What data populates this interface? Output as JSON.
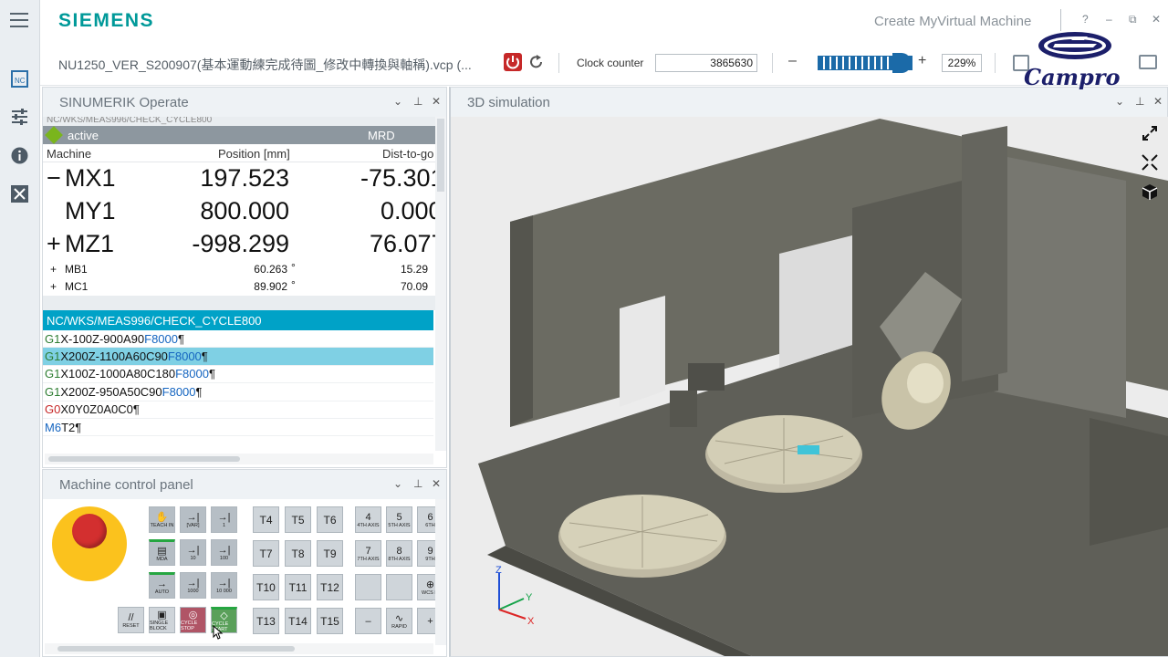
{
  "header": {
    "brand": "SIEMENS",
    "app_title": "Create MyVirtual Machine",
    "help": "?",
    "minimize": "–",
    "restore": "⧉",
    "close": "✕"
  },
  "toolbar": {
    "filename": "NU1250_VER_S200907(基本運動練完成待圖_修改中轉換與軸稱).vcp (...",
    "clock_label": "Clock counter",
    "clock_value": "3865630",
    "zoom_minus": "–",
    "zoom_plus": "+",
    "zoom_value": "229%",
    "zoom_level": 0.82
  },
  "logo": {
    "text": "Campro",
    "color": "#1c1f6a"
  },
  "left_rail": {
    "icons": [
      "menu-icon",
      "nc-icon",
      "settings-sliders-icon",
      "info-icon",
      "close-box-icon"
    ]
  },
  "sinumerik": {
    "title": "SINUMERIK Operate",
    "cut_path": "NC/WKS/MEAS996/CHECK_CYCLE800",
    "status": "active",
    "mode": "MRD",
    "headers": {
      "machine": "Machine",
      "position": "Position [mm]",
      "dist": "Dist-to-go"
    },
    "axes_big": [
      {
        "sign": "−",
        "name": "MX1",
        "pos": "197.523",
        "dist": "-75.301"
      },
      {
        "sign": "",
        "name": "MY1",
        "pos": "800.000",
        "dist": "0.000"
      },
      {
        "sign": "+",
        "name": "MZ1",
        "pos": "-998.299",
        "dist": "76.077"
      }
    ],
    "axes_small": [
      {
        "sign": "+",
        "name": "MB1",
        "pos": "60.263",
        "unit": "°",
        "dist": "15.29"
      },
      {
        "sign": "+",
        "name": "MC1",
        "pos": "89.902",
        "unit": "°",
        "dist": "70.09"
      }
    ],
    "program_path": "NC/WKS/MEAS996/CHECK_CYCLE800",
    "program": [
      {
        "g": "G1",
        "body": "X-100Z-900A90",
        "feed": "F8000",
        "end": "¶",
        "selected": false
      },
      {
        "g": "G1",
        "body": "X200Z-1100A60C90",
        "feed": "F8000",
        "end": "¶",
        "selected": true
      },
      {
        "g": "G1",
        "body": "X100Z-1000A80C180",
        "feed": "F8000",
        "end": "¶",
        "selected": false
      },
      {
        "g": "G1",
        "body": "X200Z-950A50C90",
        "feed": "F8000",
        "end": "¶",
        "selected": false
      },
      {
        "g": "G0",
        "body": "X0Y0Z0A0C0",
        "feed": "",
        "end": "¶",
        "selected": false
      },
      {
        "g": "M6",
        "body": " T2",
        "feed": "",
        "end": "¶",
        "selected": false
      }
    ]
  },
  "mcp": {
    "title": "Machine control panel",
    "mode_keys": [
      {
        "glyph": "✋",
        "label": "TEACH IN"
      },
      {
        "glyph": "→|",
        "label": "[VAR]"
      },
      {
        "glyph": "→|",
        "label": "1"
      },
      {
        "glyph": "▤",
        "label": "MDA"
      },
      {
        "glyph": "→|",
        "label": "10"
      },
      {
        "glyph": "→|",
        "label": "100"
      },
      {
        "glyph": "→",
        "label": "AUTO"
      },
      {
        "glyph": "→|",
        "label": "1000"
      },
      {
        "glyph": "→|",
        "label": "10 000"
      }
    ],
    "tool_keys": [
      "T4",
      "T5",
      "T6",
      "T7",
      "T8",
      "T9",
      "T10",
      "T11",
      "T12",
      "T13",
      "T14",
      "T15"
    ],
    "axis_keys": [
      {
        "num": "4",
        "label": "4TH AXIS"
      },
      {
        "num": "5",
        "label": "5TH AXIS"
      },
      {
        "num": "6",
        "label": "6TH"
      },
      {
        "num": "7",
        "label": "7TH AXIS"
      },
      {
        "num": "8",
        "label": "8TH AXIS"
      },
      {
        "num": "9",
        "label": "9TH"
      },
      {
        "num": "",
        "label": ""
      },
      {
        "num": "",
        "label": ""
      },
      {
        "num": "⊕",
        "label": "WCS M"
      },
      {
        "num": "–",
        "label": ""
      },
      {
        "num": "∿",
        "label": "RAPID"
      },
      {
        "num": "+",
        "label": ""
      }
    ],
    "bottom_keys": [
      {
        "glyph": "//",
        "label": "RESET"
      },
      {
        "glyph": "▣",
        "label": "SINGLE BLOCK"
      },
      {
        "glyph": "◎",
        "label": "CYCLE STOP"
      },
      {
        "glyph": "◇",
        "label": "CYCLE START"
      }
    ]
  },
  "simulation": {
    "title": "3D simulation",
    "axis_labels": {
      "x": "X",
      "y": "Y",
      "z": "Z"
    }
  },
  "panel_controls": {
    "dropdown": "⌄",
    "pin": "⊥",
    "close": "✕"
  }
}
